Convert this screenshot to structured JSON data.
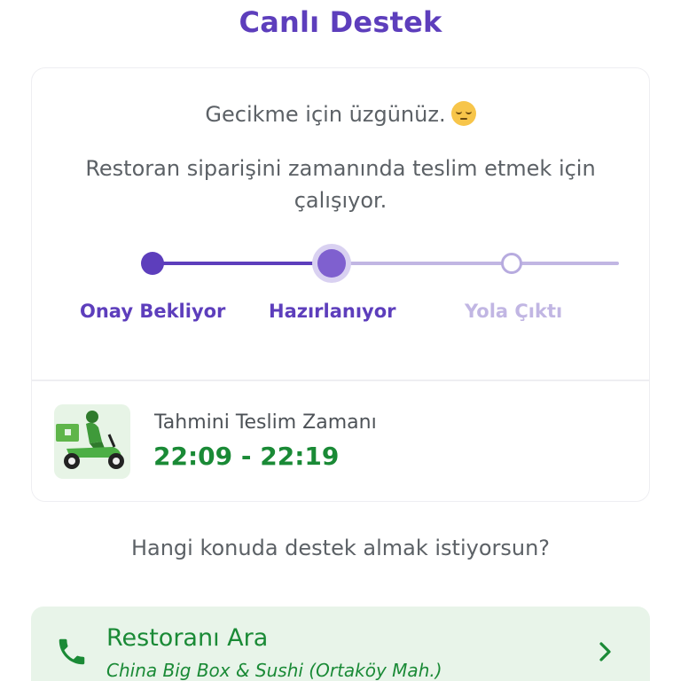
{
  "header": {
    "title": "Canlı Destek"
  },
  "status": {
    "apology": "Gecikme için üzgünüz.",
    "apology_emoji": "pensive-face-emoji",
    "message": "Restoran siparişini zamanında teslim etmek için çalışıyor.",
    "steps": [
      {
        "label": "Onay Bekliyor",
        "state": "completed"
      },
      {
        "label": "Hazırlanıyor",
        "state": "current"
      },
      {
        "label": "Yola Çıktı",
        "state": "pending"
      }
    ]
  },
  "delivery": {
    "label": "Tahmini Teslim Zamanı",
    "time_range": "22:09 - 22:19",
    "icon": "courier-scooter-icon"
  },
  "support": {
    "question": "Hangi konuda destek almak istiyorsun?",
    "call_restaurant": {
      "title": "Restoranı Ara",
      "subtitle": "China Big Box & Sushi (Ortaköy Mah.)",
      "icon": "phone-icon",
      "chevron": "chevron-right-icon"
    }
  },
  "colors": {
    "brand_purple": "#5d3ebc",
    "pending_purple": "#c1b6e3",
    "success_green": "#1a8a36",
    "green_background": "#e8f4e9",
    "text_gray": "#5c6166"
  }
}
